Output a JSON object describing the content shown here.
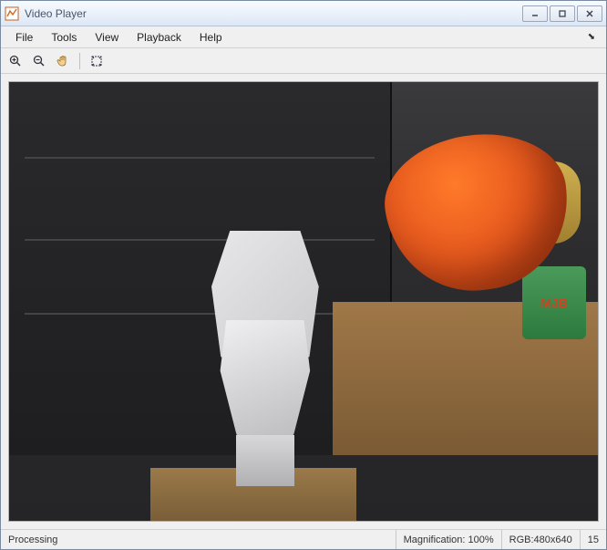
{
  "window": {
    "title": "Video Player"
  },
  "menubar": {
    "items": [
      "File",
      "Tools",
      "View",
      "Playback",
      "Help"
    ]
  },
  "toolbar": {
    "zoom_in": "zoom-in",
    "zoom_out": "zoom-out",
    "pan": "pan",
    "fit": "fit-to-window"
  },
  "scene": {
    "can_label": "MJB"
  },
  "statusbar": {
    "status": "Processing",
    "magnification_label": "Magnification: 100%",
    "format_label": "RGB:480x640",
    "frame": "15"
  }
}
